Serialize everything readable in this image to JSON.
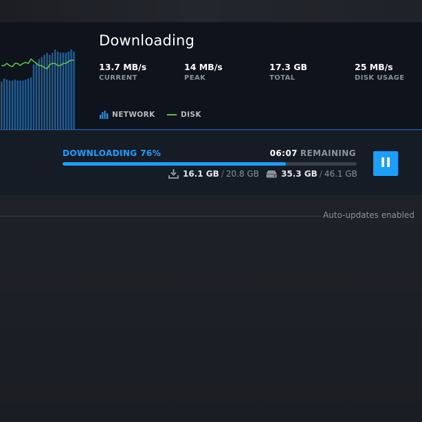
{
  "download": {
    "title": "Downloading",
    "stats": [
      {
        "value": "13.7 MB/s",
        "label": "CURRENT"
      },
      {
        "value": "14 MB/s",
        "label": "PEAK"
      },
      {
        "value": "17.3 GB",
        "label": "TOTAL"
      },
      {
        "value": "25 MB/s",
        "label": "DISK USAGE"
      }
    ],
    "legend": {
      "network": "NETWORK",
      "disk": "DISK"
    },
    "colors": {
      "accent": "#1a9fff",
      "network_bar": "#1f5f96",
      "disk_line": "#5ec24a",
      "panel_bg": "#0e131c"
    },
    "network_bars": [
      0.45,
      0.48,
      0.47,
      0.46,
      0.46,
      0.47,
      0.46,
      0.46,
      0.46,
      0.47,
      0.48,
      0.49,
      0.61,
      0.63,
      0.66,
      0.68,
      0.7,
      0.72,
      0.7,
      0.72,
      0.75,
      0.73,
      0.72,
      0.72,
      0.72,
      0.73,
      0.75,
      0.73
    ],
    "disk_line": [
      0.6,
      0.6,
      0.62,
      0.6,
      0.59,
      0.62,
      0.62,
      0.6,
      0.62,
      0.63,
      0.62,
      0.66,
      0.64,
      0.62,
      0.6,
      0.6,
      0.58,
      0.57,
      0.61,
      0.62,
      0.62,
      0.6,
      0.6,
      0.62,
      0.62,
      0.64,
      0.65,
      0.65
    ]
  },
  "progress": {
    "status": "DOWNLOADING 76%",
    "percent": 76,
    "time": "06:07",
    "remaining_label": "REMAINING",
    "download_current": "16.1 GB",
    "download_total": "20.8 GB",
    "disk_current": "35.3 GB",
    "disk_total": "46.1 GB",
    "separator": "/",
    "pause_icon": "pause-icon"
  },
  "footer": {
    "auto_updates": "Auto-updates enabled"
  }
}
